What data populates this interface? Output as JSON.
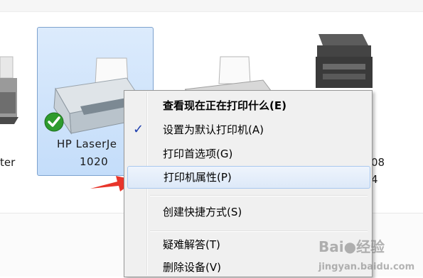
{
  "devices": [
    {
      "id": "left-partial",
      "label": "ter"
    },
    {
      "id": "hp-laserjet",
      "name_line1": "HP LaserJe",
      "name_line2": "1020",
      "selected": true,
      "default": true
    },
    {
      "id": "printer-middle"
    },
    {
      "id": "multifunction-right",
      "label_line1": "08",
      "label_line2": "4"
    }
  ],
  "context_menu": {
    "items": [
      {
        "label": "查看现在正在打印什么(E)",
        "bold": true
      },
      {
        "label": "设置为默认打印机(A)",
        "checked": true
      },
      {
        "label": "打印首选项(G)"
      },
      {
        "label": "打印机属性(P)",
        "highlighted": true
      },
      {
        "label": "创建快捷方式(S)"
      },
      {
        "label": "疑难解答(T)"
      },
      {
        "label": "删除设备(V)"
      }
    ],
    "check_glyph": "✓"
  },
  "annotation": {
    "arrow_color": "#e8352a"
  },
  "watermark": {
    "text": "Bai",
    "suffix": "经验",
    "sub": "jingyan.baidu.com"
  }
}
